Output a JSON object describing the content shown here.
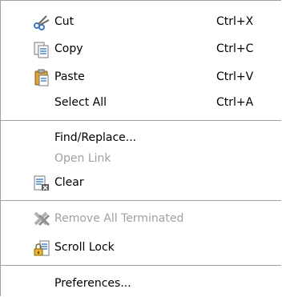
{
  "menu": {
    "items": [
      {
        "label": "Cut",
        "shortcut": "Ctrl+X",
        "icon": "scissors-icon",
        "enabled": true
      },
      {
        "label": "Copy",
        "shortcut": "Ctrl+C",
        "icon": "copy-icon",
        "enabled": true
      },
      {
        "label": "Paste",
        "shortcut": "Ctrl+V",
        "icon": "paste-icon",
        "enabled": true
      },
      {
        "label": "Select All",
        "shortcut": "Ctrl+A",
        "enabled": true
      },
      {
        "label": "Find/Replace...",
        "enabled": true
      },
      {
        "label": "Open Link",
        "enabled": false
      },
      {
        "label": "Clear",
        "icon": "clear-console-icon",
        "enabled": true
      },
      {
        "label": "Remove All Terminated",
        "icon": "remove-all-terminated-icon",
        "enabled": false
      },
      {
        "label": "Scroll Lock",
        "icon": "scroll-lock-icon",
        "enabled": true
      },
      {
        "label": "Preferences...",
        "enabled": true
      }
    ]
  },
  "colors": {
    "text": "#000000",
    "disabled_text": "#a0a0a0",
    "separator": "#a0a0a0",
    "background": "#ffffff"
  }
}
